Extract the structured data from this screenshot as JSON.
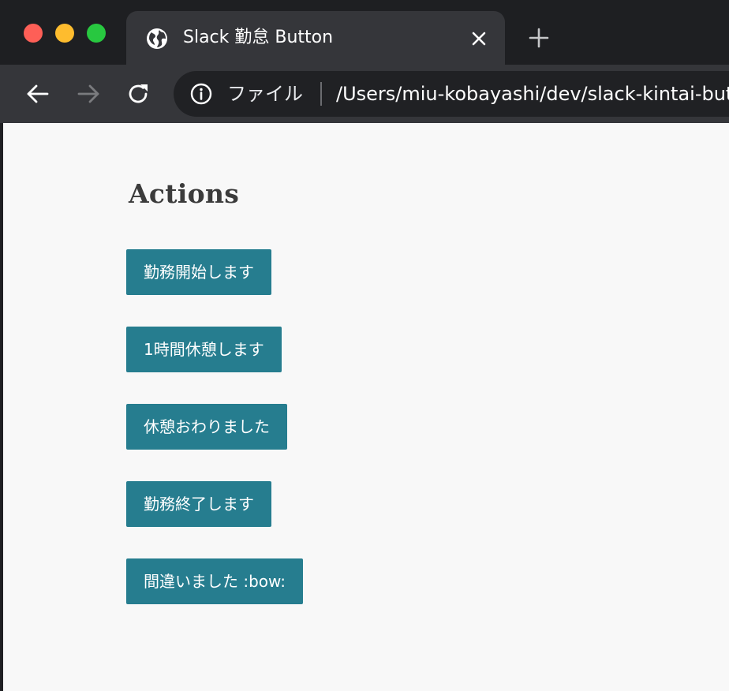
{
  "browser": {
    "tab": {
      "title": "Slack 勤怠 Button"
    },
    "address_bar": {
      "scheme_label": "ファイル",
      "url": "/Users/miu-kobayashi/dev/slack-kintai-button/index.html"
    },
    "icons": {
      "tab_favicon": "globe-icon",
      "tab_close": "close-icon",
      "new_tab": "plus-icon",
      "back": "arrow-left-icon",
      "forward": "arrow-right-icon",
      "reload": "reload-icon",
      "site_info": "info-icon"
    },
    "colors": {
      "close_button": "#fe5f57",
      "minimize_button": "#febc2e",
      "zoom_button": "#28c840"
    }
  },
  "page": {
    "title": "Actions",
    "buttons": [
      {
        "label": "勤務開始します"
      },
      {
        "label": "1時間休憩します"
      },
      {
        "label": "休憩おわりました"
      },
      {
        "label": "勤務終了します"
      },
      {
        "label": "間違いました :bow:"
      }
    ],
    "colors": {
      "button_bg": "#267d8f",
      "button_text": "#ffffff",
      "background": "#f8f8f8",
      "title_text": "#3b3b3b"
    }
  }
}
